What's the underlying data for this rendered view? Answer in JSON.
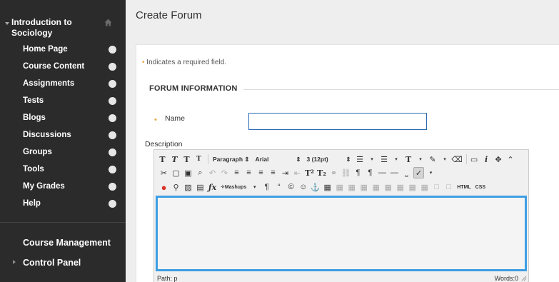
{
  "sidebar": {
    "course_title": "Introduction to Sociology",
    "items": [
      {
        "label": "Home Page"
      },
      {
        "label": "Course Content"
      },
      {
        "label": "Assignments"
      },
      {
        "label": "Tests"
      },
      {
        "label": "Blogs"
      },
      {
        "label": "Discussions"
      },
      {
        "label": "Groups"
      },
      {
        "label": "Tools"
      },
      {
        "label": "My Grades"
      },
      {
        "label": "Help"
      }
    ],
    "course_management": "Course Management",
    "control_panel": "Control Panel"
  },
  "page": {
    "title": "Create Forum",
    "required_note": "Indicates a required field.",
    "required_marker": "•",
    "section_title": "FORUM INFORMATION",
    "name_label": "Name",
    "name_value": "",
    "description_label": "Description"
  },
  "editor": {
    "format_select": "Paragraph ⇕",
    "font_select": "Arial",
    "size_select": "3 (12pt)",
    "mashups_label": "Mashups",
    "html_label": "HTML",
    "css_label": "CSS",
    "path_label": "Path: p",
    "words_label": "Words:0"
  },
  "colors": {
    "sidebar_bg": "#2b2b2b",
    "required_star": "#e8a33d",
    "focus_border": "#3d9ee4",
    "input_border": "#2a6ab5"
  }
}
